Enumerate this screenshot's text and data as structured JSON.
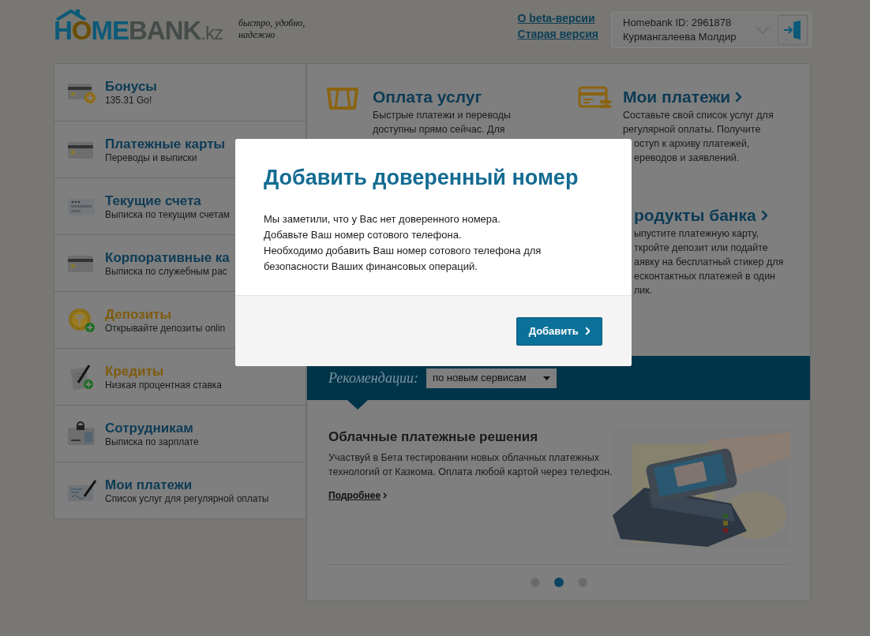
{
  "header": {
    "logo": {
      "parts": [
        {
          "text": "H",
          "color": "#0c5a78"
        },
        {
          "text": "O",
          "color": "#6b4e00"
        },
        {
          "text": "ME",
          "color": "#0c5a78"
        },
        {
          "text": "BANK",
          "color": "#444c49"
        },
        {
          "text": ".kz",
          "color": "#444c49"
        }
      ]
    },
    "tagline": [
      "быстро, удобно,",
      "надежно"
    ],
    "links": [
      "О beta-версии",
      "Старая версия"
    ],
    "user": {
      "id_line": "Homebank ID: 2961878",
      "name": "Курмангалеева Молдир"
    }
  },
  "sidebar": {
    "items": [
      {
        "kind": "bonus",
        "title": "Бонусы",
        "subtitle": "135.31 Go!",
        "highlight": false
      },
      {
        "kind": "card",
        "title": "Платежные карты",
        "subtitle": "Переводы и выписки",
        "highlight": false
      },
      {
        "kind": "account",
        "title": "Текущие счета",
        "subtitle": "Выписка по текущим счетам",
        "highlight": false
      },
      {
        "kind": "card",
        "title": "Корпоративные ка",
        "subtitle": "Выписка по служебным рас",
        "highlight": false
      },
      {
        "kind": "coin",
        "title": "Депозиты",
        "subtitle": "Открывайте депозиты onlin",
        "highlight": true
      },
      {
        "kind": "pen",
        "title": "Кредиты",
        "subtitle": "Низкая процентная ставка",
        "highlight": true
      },
      {
        "kind": "badge",
        "title": "Сотрудникам",
        "subtitle": "Выписка по зарплате",
        "highlight": false
      },
      {
        "kind": "check",
        "title": "Мои платежи",
        "subtitle": "Список услуг для регулярной оплаты",
        "highlight": false
      }
    ]
  },
  "services": [
    {
      "kind": "road",
      "title": "Оплата услуг",
      "arrow": false,
      "lines": [
        "Быстрые платежи и переводы",
        "доступны прямо сейчас. Для"
      ]
    },
    {
      "kind": "wallet",
      "title": "Мои платежи",
      "arrow": true,
      "lines": [
        "Составьте свой список услуг для",
        "регулярной оплаты. Получите",
        "оступ к архиву платежей,",
        "ереводов и заявлений."
      ]
    },
    {
      "title": "родукты банка",
      "arrow": true,
      "lines": [
        "ыпустите платежную карту,",
        "ткройте депозит или подайте",
        "аявку на бесплатный стикер для",
        "есконтактных платежей в один",
        "лик."
      ]
    }
  ],
  "recommendations": {
    "label": "Рекомендации:",
    "select": "по новым сервисам"
  },
  "promo": {
    "title": "Облачные платежные решения",
    "text": "Участвуй в Бета тестировании новых облачных платежных технологий от Казкома. Оплата любой картой через телефон.",
    "link": "Подробнее"
  },
  "carousel": {
    "dots": [
      {
        "selected": false
      },
      {
        "selected": true
      },
      {
        "selected": false
      }
    ]
  },
  "modal": {
    "title": "Добавить доверенный номер",
    "lines": [
      "Мы заметили, что у Вас нет доверенного номера.",
      "Добавьте Ваш номер сотового телефона.",
      "Необходимо добавить Ваш номер сотового телефона для",
      "безопасности Ваших финансовых операций."
    ],
    "button": "Добавить"
  }
}
